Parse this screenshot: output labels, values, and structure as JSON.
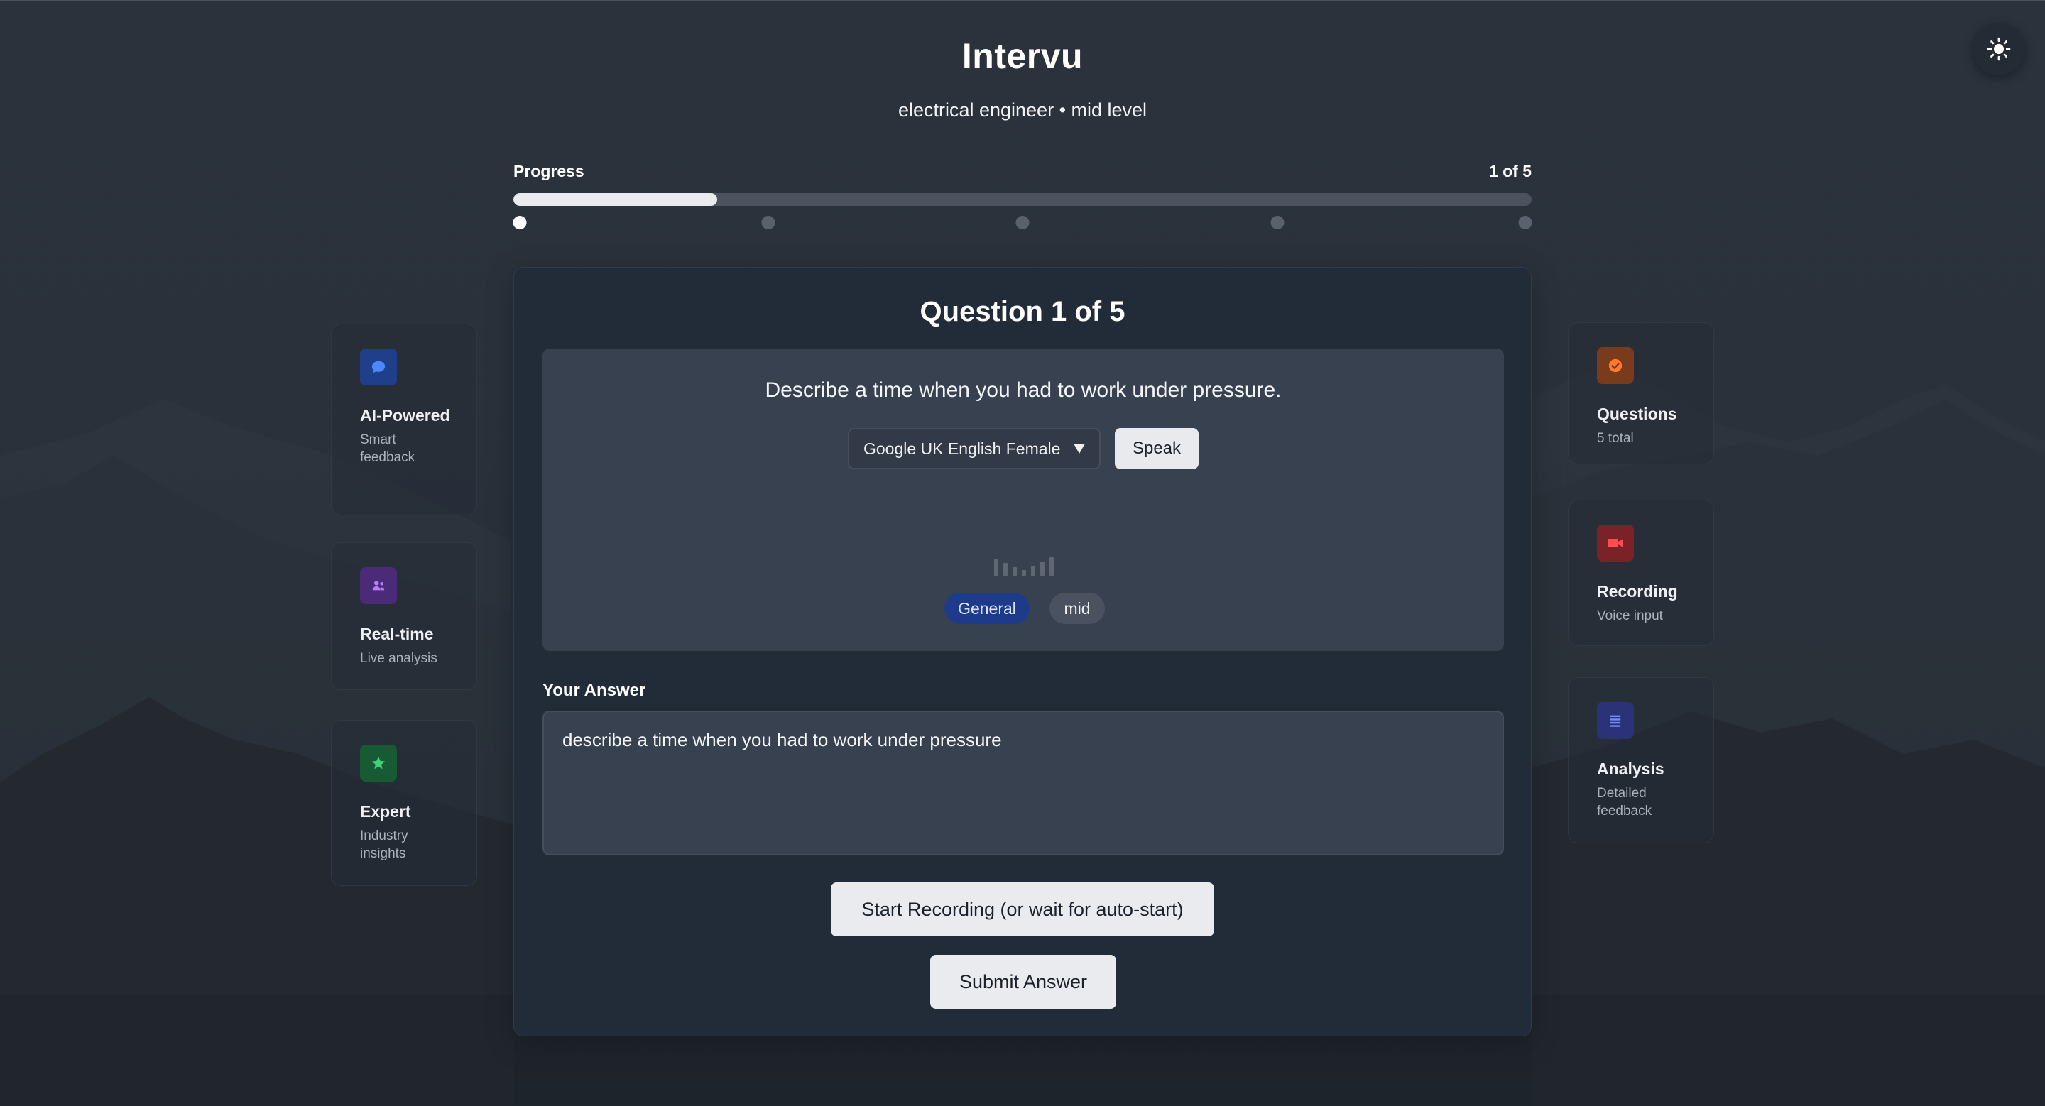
{
  "app": {
    "title": "Intervu",
    "subtitle": "electrical engineer • mid level"
  },
  "progress": {
    "label": "Progress",
    "count_text": "1 of 5",
    "current": 1,
    "total": 5,
    "fill_fraction": 0.2
  },
  "question": {
    "heading": "Question 1 of 5",
    "text": "Describe a time when you had to work under pressure.",
    "voice_selected": "Google UK English Female",
    "speak_label": "Speak",
    "category_tag": "General",
    "level_tag": "mid"
  },
  "answer": {
    "label": "Your Answer",
    "value": "describe a time when you had to work under pressure"
  },
  "actions": {
    "record_label": "Start Recording (or wait for auto-start)",
    "submit_label": "Submit Answer"
  },
  "features_left": [
    {
      "title": "AI-Powered",
      "subtitle": "Smart feedback",
      "icon": "chat-bubble-icon",
      "color": "#2f5fd0"
    },
    {
      "title": "Real-time",
      "subtitle": "Live analysis",
      "icon": "users-icon",
      "color": "#6b3fa8"
    },
    {
      "title": "Expert",
      "subtitle": "Industry insights",
      "icon": "star-icon",
      "color": "#1f7a45"
    }
  ],
  "features_right": [
    {
      "title": "Questions",
      "subtitle": "5 total",
      "icon": "check-circle-icon",
      "color": "#e0651f"
    },
    {
      "title": "Recording",
      "subtitle": "Voice input",
      "icon": "video-camera-icon",
      "color": "#d63b3b"
    },
    {
      "title": "Analysis",
      "subtitle": "Detailed feedback",
      "icon": "list-icon",
      "color": "#4450c0"
    }
  ],
  "theme_toggle_icon": "sun-icon"
}
